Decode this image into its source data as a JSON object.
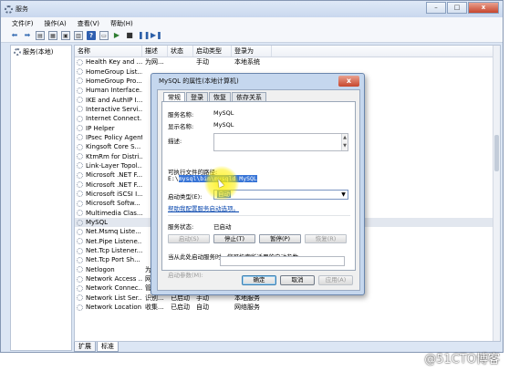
{
  "window": {
    "title": "服务",
    "controls": {
      "min": "–",
      "max": "□",
      "close": "x"
    }
  },
  "menu": [
    "文件(F)",
    "操作(A)",
    "查看(V)",
    "帮助(H)"
  ],
  "toolbar_icons": [
    "back-icon",
    "forward-icon",
    "view-icon",
    "list-icon",
    "export-icon",
    "properties-icon",
    "help-icon",
    "play-icon",
    "stop-icon",
    "pause-icon",
    "restart-icon"
  ],
  "tree": {
    "root": "服务(本地)"
  },
  "columns": [
    "名称",
    "描述",
    "状态",
    "启动类型",
    "登录为"
  ],
  "rows": [
    {
      "name": "Health Key and ...",
      "desc": "为网...",
      "status": "",
      "startup": "手动",
      "logon": "本地系统"
    },
    {
      "name": "HomeGroup List...",
      "desc": "",
      "status": "",
      "startup": "",
      "logon": ""
    },
    {
      "name": "HomeGroup Pro...",
      "desc": "",
      "status": "",
      "startup": "",
      "logon": ""
    },
    {
      "name": "Human Interface...",
      "desc": "",
      "status": "",
      "startup": "",
      "logon": ""
    },
    {
      "name": "IKE and AuthIP I...",
      "desc": "",
      "status": "",
      "startup": "",
      "logon": ""
    },
    {
      "name": "Interactive Servi...",
      "desc": "",
      "status": "",
      "startup": "",
      "logon": ""
    },
    {
      "name": "Internet Connect...",
      "desc": "",
      "status": "",
      "startup": "",
      "logon": ""
    },
    {
      "name": "IP Helper",
      "desc": "",
      "status": "",
      "startup": "",
      "logon": ""
    },
    {
      "name": "IPsec Policy Agent",
      "desc": "",
      "status": "",
      "startup": "",
      "logon": ""
    },
    {
      "name": "Kingsoft Core S...",
      "desc": "",
      "status": "",
      "startup": "",
      "logon": ""
    },
    {
      "name": "KtmRm for Distri...",
      "desc": "",
      "status": "",
      "startup": "",
      "logon": ""
    },
    {
      "name": "Link-Layer Topol...",
      "desc": "",
      "status": "",
      "startup": "",
      "logon": ""
    },
    {
      "name": "Microsoft .NET F...",
      "desc": "",
      "status": "",
      "startup": "",
      "logon": ""
    },
    {
      "name": "Microsoft .NET F...",
      "desc": "",
      "status": "",
      "startup": "",
      "logon": ""
    },
    {
      "name": "Microsoft iSCSI I...",
      "desc": "",
      "status": "",
      "startup": "",
      "logon": ""
    },
    {
      "name": "Microsoft Softw...",
      "desc": "",
      "status": "",
      "startup": "",
      "logon": ""
    },
    {
      "name": "Multimedia Clas...",
      "desc": "",
      "status": "",
      "startup": "",
      "logon": ""
    },
    {
      "name": "MySQL",
      "desc": "",
      "status": "",
      "startup": "",
      "logon": "",
      "selected": true
    },
    {
      "name": "Net.Msmq Liste...",
      "desc": "",
      "status": "",
      "startup": "",
      "logon": ""
    },
    {
      "name": "Net.Pipe Listene...",
      "desc": "",
      "status": "",
      "startup": "",
      "logon": ""
    },
    {
      "name": "Net.Tcp Listener...",
      "desc": "",
      "status": "",
      "startup": "",
      "logon": ""
    },
    {
      "name": "Net.Tcp Port Sh...",
      "desc": "",
      "status": "",
      "startup": "",
      "logon": ""
    },
    {
      "name": "Netlogon",
      "desc": "为用...",
      "status": "",
      "startup": "手动",
      "logon": "本地系统"
    },
    {
      "name": "Network Access ...",
      "desc": "网络...",
      "status": "",
      "startup": "手动",
      "logon": "网络服务"
    },
    {
      "name": "Network Connec...",
      "desc": "管理...",
      "status": "已启动",
      "startup": "手动",
      "logon": "本地系统"
    },
    {
      "name": "Network List Ser...",
      "desc": "识别...",
      "status": "已启动",
      "startup": "手动",
      "logon": "本地服务"
    },
    {
      "name": "Network Location ...",
      "desc": "收集...",
      "status": "已启动",
      "startup": "自动",
      "logon": "网络服务"
    }
  ],
  "bottom_tabs": [
    "扩展",
    "标准"
  ],
  "dialog": {
    "title": "MySQL 的属性(本地计算机)",
    "close": "x",
    "tabs": [
      "常规",
      "登录",
      "恢复",
      "依存关系"
    ],
    "service_name_label": "服务名称:",
    "service_name": "MySQL",
    "display_name_label": "显示名称:",
    "display_name": "MySQL",
    "description_label": "描述:",
    "path_label": "可执行文件的路径:",
    "path_prefix": "E:\\",
    "path_highlight": "mysql\\bin\\mysqld MySQL",
    "startup_type_label": "启动类型(E):",
    "startup_type_value": "自动",
    "help_link": "帮助我配置服务启动选项。",
    "service_status_label": "服务状态:",
    "service_status": "已启动",
    "buttons": {
      "start": "启动(S)",
      "stop": "停止(T)",
      "pause": "暂停(P)",
      "resume": "恢复(R)"
    },
    "hint": "当从此处启动服务时，您可指定所适用的启动参数。",
    "params_label": "启动参数(M):",
    "ok": "确定",
    "cancel": "取消",
    "apply": "应用(A)"
  },
  "watermark": "@51CTO博客"
}
